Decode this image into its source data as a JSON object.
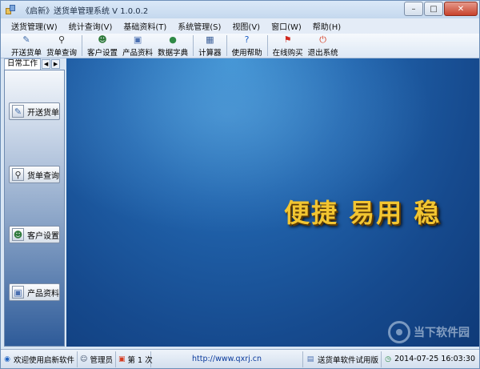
{
  "window": {
    "title": "《启新》送货单管理系统 V 1.0.0.2",
    "controls": {
      "minimize": "–",
      "maximize": "□",
      "close": "✕"
    }
  },
  "menu": [
    "送货管理(W)",
    "统计查询(V)",
    "基础资料(T)",
    "系统管理(S)",
    "视图(V)",
    "窗口(W)",
    "帮助(H)"
  ],
  "toolbar": {
    "groups": [
      [
        {
          "label": "开送货单",
          "icon": "edit-icon",
          "glyph": "✎",
          "color": "#3d6aa8"
        },
        {
          "label": "货单查询",
          "icon": "search-icon",
          "glyph": "⚲",
          "color": "#333333"
        }
      ],
      [
        {
          "label": "客户设置",
          "icon": "customer-icon",
          "glyph": "☻",
          "color": "#2f7a3b"
        },
        {
          "label": "产品资料",
          "icon": "product-icon",
          "glyph": "▣",
          "color": "#4a6fb0"
        },
        {
          "label": "数据字典",
          "icon": "dictionary-icon",
          "glyph": "●",
          "color": "#2f8a46"
        }
      ],
      [
        {
          "label": "计算器",
          "icon": "calculator-icon",
          "glyph": "▦",
          "color": "#3b5f99"
        }
      ],
      [
        {
          "label": "使用帮助",
          "icon": "help-icon",
          "glyph": "?",
          "color": "#1d5fc4"
        }
      ],
      [
        {
          "label": "在线购买",
          "icon": "flag-icon",
          "glyph": "⚑",
          "color": "#d0281e"
        },
        {
          "label": "退出系统",
          "icon": "exit-icon",
          "glyph": "⏻",
          "color": "#d53a1f"
        }
      ]
    ]
  },
  "sidebar": {
    "tab": "日常工作",
    "arrows": [
      "◀",
      "▶"
    ],
    "buttons": [
      {
        "label": "开送货单",
        "icon": "edit-icon",
        "glyph": "✎",
        "color": "#3d6aa8"
      },
      {
        "label": "货单查询",
        "icon": "search-icon",
        "glyph": "⚲",
        "color": "#333333"
      },
      {
        "label": "客户设置",
        "icon": "customer-icon",
        "glyph": "☻",
        "color": "#2f7a3b"
      },
      {
        "label": "产品资料",
        "icon": "product-icon",
        "glyph": "▣",
        "color": "#4a6fb0"
      }
    ]
  },
  "main": {
    "slogan": "便捷  易用  稳",
    "watermark": "当下软件园"
  },
  "status": {
    "welcome": "欢迎使用启新软件",
    "user": "管理员",
    "login_count": "第 1 次",
    "url": "http://www.qxrj.cn",
    "edition": "送货单软件试用版",
    "datetime": "2014-07-25 16:03:30"
  }
}
